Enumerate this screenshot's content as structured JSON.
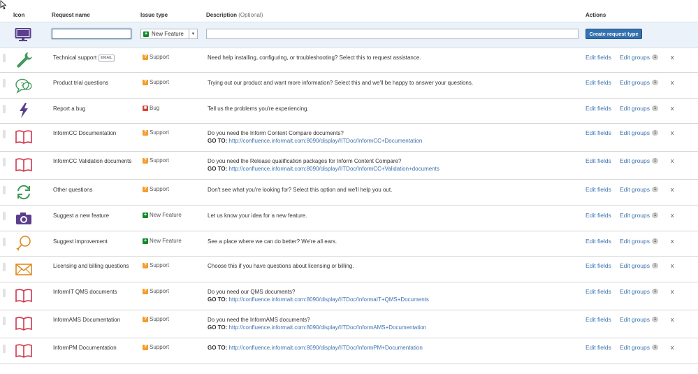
{
  "headers": {
    "icon": "Icon",
    "request_name": "Request name",
    "issue_type": "Issue type",
    "description": "Description",
    "description_optional": "(Optional)",
    "actions": "Actions"
  },
  "create_form": {
    "icon": "monitor-icon",
    "name_value": "",
    "issue_type_selected": "New Feature",
    "description_value": "",
    "create_button": "Create request type"
  },
  "colors": {
    "accent": "#3572b0",
    "link": "#3b73af",
    "support": "#f59b2a",
    "bug": "#d04437",
    "new_feature": "#14892c",
    "icon_purple": "#5b3f8c",
    "icon_green": "#3f9a5a",
    "icon_red": "#d0354a",
    "icon_orange": "#e08a1e"
  },
  "actions": {
    "edit_fields": "Edit fields",
    "edit_groups": "Edit groups",
    "remove": "x"
  },
  "rows": [
    {
      "icon": "wrench-icon",
      "name": "Technical support",
      "badge": "EMAIL",
      "type": "Support",
      "desc": "Need help installing, configuring, or troubleshooting? Select this to request assistance.",
      "goto": "",
      "link": "",
      "groups": "1"
    },
    {
      "icon": "speech-question-icon",
      "name": "Product trial questions",
      "badge": "",
      "type": "Support",
      "desc": "Trying out our product and want more information? Select this and we'll be happy to answer your questions.",
      "goto": "",
      "link": "",
      "groups": "1"
    },
    {
      "icon": "lightning-icon",
      "name": "Report a bug",
      "badge": "",
      "type": "Bug",
      "desc": "Tell us the problems you're experiencing.",
      "goto": "",
      "link": "",
      "groups": "1"
    },
    {
      "icon": "book-icon",
      "name": "InformCC Documentation",
      "badge": "",
      "type": "Support",
      "desc": "Do you need the Inform Content Compare documents?",
      "goto": "GO TO:",
      "link": "http://confluence.informait.com:8090/display/IITDoc/InformCC+Documentation",
      "groups": "1"
    },
    {
      "icon": "book-icon",
      "name": "InformCC Validation documents",
      "badge": "",
      "type": "Support",
      "desc": "Do you need the Release qualification packages for Inform Content Compare?",
      "goto": "GO TO:",
      "link": "http://confluence.informait.com:8090/display/IITDoc/InformCC+Validation+documents",
      "groups": "1"
    },
    {
      "icon": "refresh-icon",
      "name": "Other questions",
      "badge": "",
      "type": "Support",
      "desc": "Don't see what you're looking for? Select this option and we'll help you out.",
      "goto": "",
      "link": "",
      "groups": "1"
    },
    {
      "icon": "camera-icon",
      "name": "Suggest a new feature",
      "badge": "",
      "type": "New Feature",
      "desc": "Let us know your idea for a new feature.",
      "goto": "",
      "link": "",
      "groups": "1"
    },
    {
      "icon": "lightbulb-icon",
      "name": "Suggest improvement",
      "badge": "",
      "type": "New Feature",
      "desc": "See a place where we can do better? We're all ears.",
      "goto": "",
      "link": "",
      "groups": "1"
    },
    {
      "icon": "envelope-icon",
      "name": "Licensing and billing questions",
      "badge": "",
      "type": "Support",
      "desc": "Choose this if you have questions about licensing or billing.",
      "goto": "",
      "link": "",
      "groups": "1"
    },
    {
      "icon": "book-icon",
      "name": "InformIT QMS documents",
      "badge": "",
      "type": "Support",
      "desc": "Do you need our QMS documents?",
      "goto": "GO TO:",
      "link": "http://confluence.informait.com:8090/display/IITDoc/InformaIT+QMS+Documents",
      "groups": "1"
    },
    {
      "icon": "book-icon",
      "name": "InformAMS Documentation",
      "badge": "",
      "type": "Support",
      "desc": "Do you need the InformAMS documents?",
      "goto": "GO TO:",
      "link": "http://confluence.informait.com:8090/display/IITDoc/InformAMS+Documentation",
      "groups": "1"
    },
    {
      "icon": "book-icon",
      "name": "InformPM Documentation",
      "badge": "",
      "type": "Support",
      "desc": "",
      "goto": "GO TO:",
      "link": "http://confluence.informait.com:8090/display/IITDoc/InformPM+Documentation",
      "groups": "1"
    }
  ]
}
